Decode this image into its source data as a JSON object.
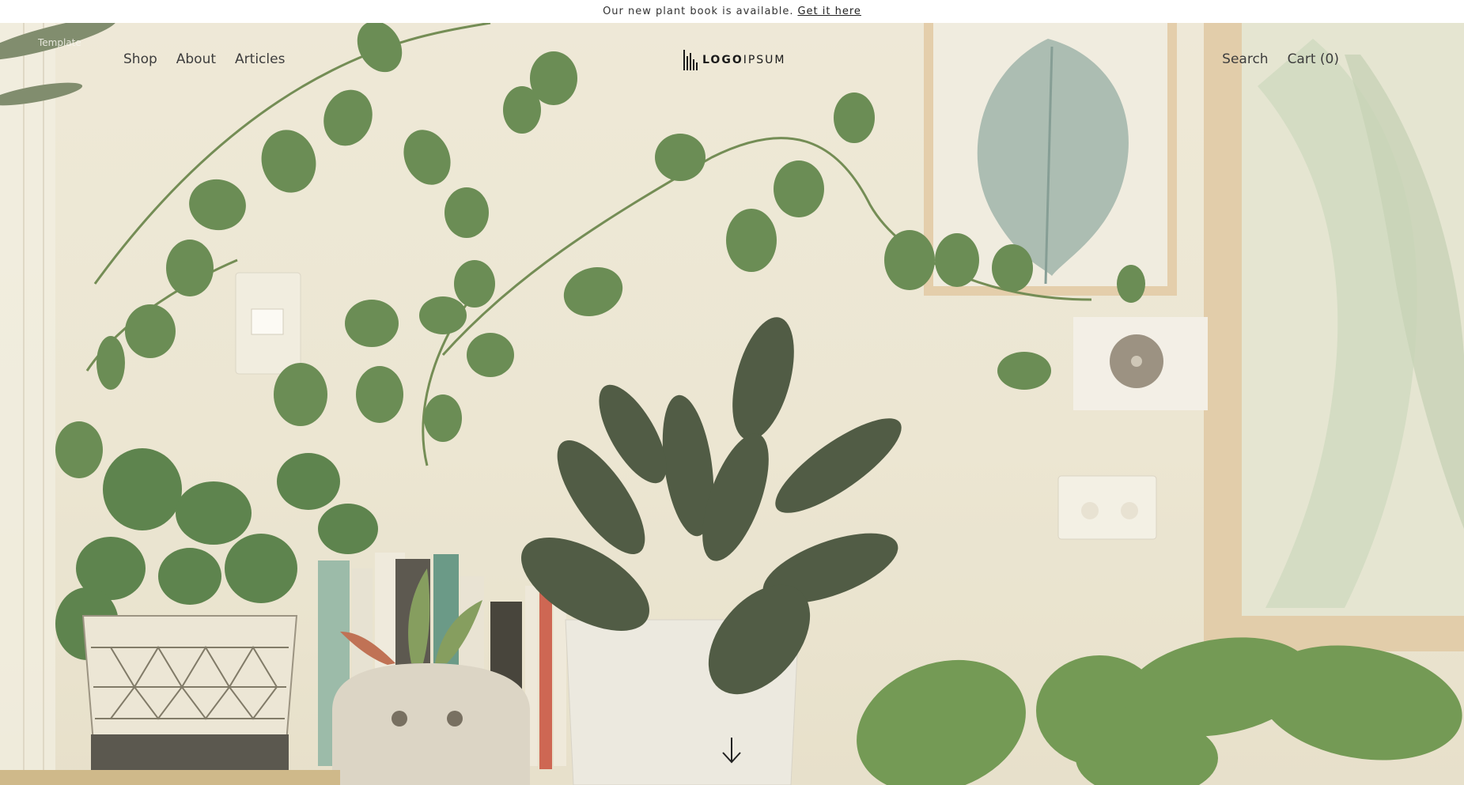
{
  "announcement": {
    "text": "Our new plant book is available.",
    "link_label": "Get it here"
  },
  "template_tag": "Template",
  "nav_left": {
    "items": [
      {
        "label": "Shop"
      },
      {
        "label": "About"
      },
      {
        "label": "Articles"
      }
    ]
  },
  "logo": {
    "bold": "LOGO",
    "light": "IPSUM"
  },
  "nav_right": {
    "search_label": "Search",
    "cart_label": "Cart (0)"
  },
  "hero": {
    "scroll_icon": "arrow-down-icon"
  },
  "colors": {
    "wall": "#ece7d6",
    "leaf": "#4f7a3e",
    "leaf_dark": "#2f3f2a",
    "frame": "#e0c9a5",
    "text": "#3d3d3d"
  }
}
